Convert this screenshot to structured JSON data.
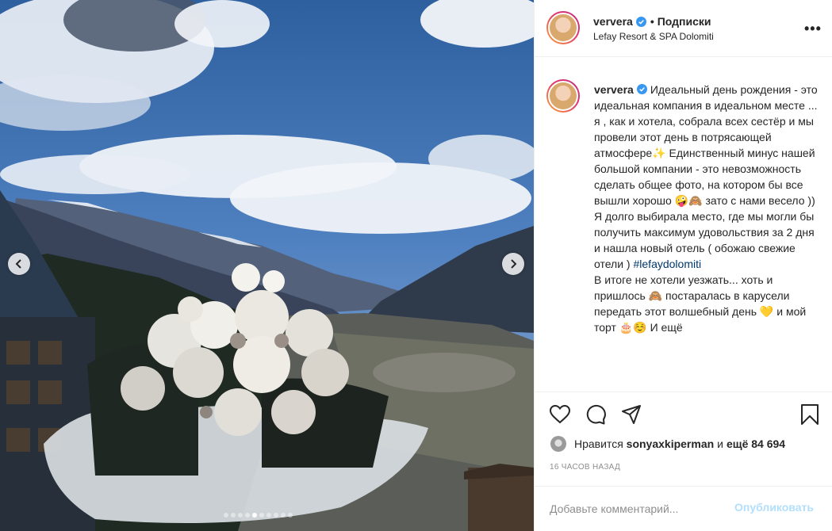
{
  "post": {
    "username": "ververa",
    "follow_label": "Подписки",
    "bullet": "•",
    "location": "Lefay Resort & SPA Dolomiti",
    "more_label": "•••"
  },
  "caption": {
    "username": "ververa",
    "text_part1": "Идеальный день рождения - это идеальная компания в идеальном месте ... я , как и хотела, собрала всех сестёр и мы провели этот день в потрясающей атмосфере✨ Единственный минус нашей большой компании - это невозможность сделать общее фото, на котором бы все вышли хорошо 🤪🙈 зато с нами весело )) Я долго выбирала место, где мы могли бы получить максимум удовольствия за 2 дня и нашла новый отель ( обожаю свежие отели ) ",
    "hashtag": "#lefaydolomiti",
    "text_part2": "В итоге не хотели уезжать... хоть и пришлось 🙈 постаралась в карусели передать этот волшебный день 💛 и мой торт 🎂☺️ И ещё"
  },
  "likes": {
    "prefix": "Нравится",
    "user": "sonyaxkiperman",
    "middle": "и",
    "count": "ещё 84 694"
  },
  "timestamp": "16 ЧАСОВ НАЗАД",
  "comment": {
    "placeholder": "Добавьте комментарий...",
    "publish_label": "Опубликовать"
  },
  "carousel": {
    "total_dots": 10,
    "active_index": 4
  },
  "colors": {
    "verified": "#3897f0",
    "hashtag": "#00376b",
    "publish_disabled": "#b2dffc",
    "muted": "#8e8e8e"
  },
  "icons": [
    "chevron-left-icon",
    "chevron-right-icon",
    "verified-badge-icon",
    "heart-icon",
    "comment-icon",
    "share-icon",
    "bookmark-icon"
  ]
}
